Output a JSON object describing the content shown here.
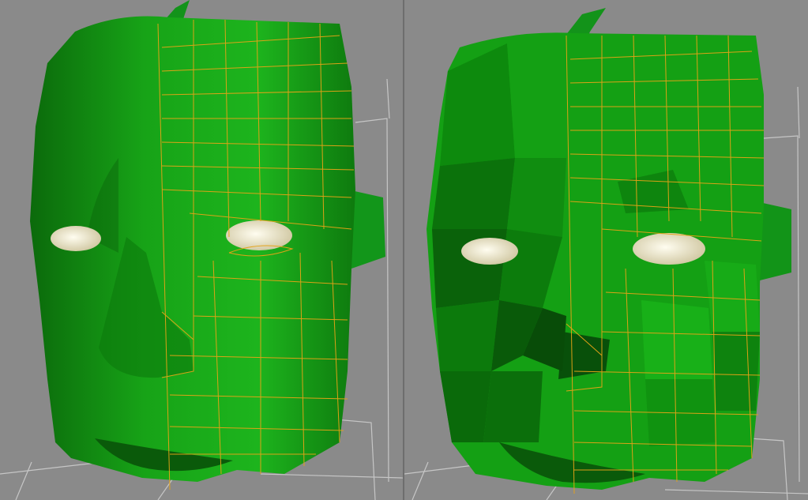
{
  "app": {
    "type": "3d-modeling-viewports"
  },
  "colors": {
    "background": "#8a8a8a",
    "mesh_green": "#16a816",
    "mesh_dark": "#0b6d0b",
    "wire_orange": "#e6a317",
    "eye": "#efe9c6",
    "grid": "#d6d6d6"
  },
  "viewports": [
    {
      "id": "left",
      "shading": "smooth-shaded",
      "wireframe_overlay": "right-half"
    },
    {
      "id": "right",
      "shading": "faceted",
      "wireframe_overlay": "right-half"
    }
  ]
}
